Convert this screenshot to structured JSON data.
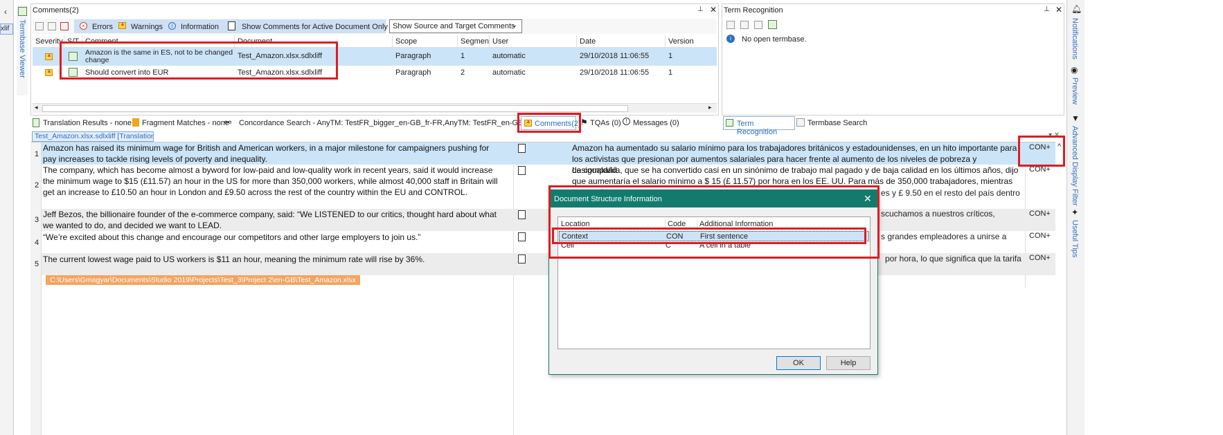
{
  "comments_panel": {
    "title": "Comments(2)",
    "toolbar": {
      "errors_label": "Errors",
      "warnings_label": "Warnings",
      "information_label": "Information",
      "active_doc_label": "Show Comments for Active Document Only",
      "dropdown_value": "Show Source and Target Comments"
    },
    "columns": [
      "Severity",
      "S/T",
      "Comment",
      "Document",
      "Scope",
      "Segmen",
      "User",
      "Date",
      "Version"
    ],
    "rows": [
      {
        "comment": "Amazon is the same in ES, not to be changed change",
        "comment_line1": "Amazon is the same in ES, not to be changed",
        "comment_line2": "change",
        "document": "Test_Amazon.xlsx.sdlxliff",
        "scope": "Paragraph",
        "segment": "1",
        "user": "automatic",
        "date": "29/10/2018 11:06:55",
        "version": "1"
      },
      {
        "comment": "Should convert into EUR",
        "document": "Test_Amazon.xlsx.sdlxliff",
        "scope": "Paragraph",
        "segment": "2",
        "user": "automatic",
        "date": "29/10/2018 11:06:55",
        "version": "1"
      }
    ]
  },
  "term_panel": {
    "title": "Term Recognition",
    "message": "No open termbase.",
    "tab_term": "Term Recognition",
    "tab_search": "Termbase Search"
  },
  "bottom_tabs": {
    "translation_results": "Translation Results - none",
    "fragment_matches": "Fragment Matches - none",
    "concordance": "Concordance Search - AnyTM: TestFR_bigger_en-GB_fr-FR,AnyTM: TestFR_en-GB_fr-FR",
    "comments": "Comments(2)",
    "tqas": "TQAs (0)",
    "messages": "Messages (0)"
  },
  "editor": {
    "doc_tab": "Test_Amazon.xlsx.sdlxliff [Translation]",
    "left_tab_fragment": "xlif",
    "file_path": "C:\\Users\\Gmagyar\\Documents\\Studio 2019\\Projects\\Test_3\\Project 2\\en-GB\\Test_Amazon.xlsx",
    "segments": [
      {
        "num": "1",
        "status": "CON+",
        "source": "Amazon has raised its minimum wage for British and American workers, in a major milestone for campaigners pushing for pay increases to tackle rising levels of poverty and inequality.",
        "target": "Amazon ha aumentado su salario mínimo para los trabajadores británicos y estadounidenses, en un hito importante para los activistas que presionan por aumentos salariales para hacer frente al aumento de los niveles de pobreza y desigualdad."
      },
      {
        "num": "2",
        "status": "CON+",
        "source": "The company, which has become almost a byword for low-paid and low-quality work in recent years, said it would increase the minimum wage to $15 (£11.57) an hour in the US for more than 350,000 workers, while almost 40,000 staff in Britain will get an increase to £10.50 an hour in London and £9.50 across the rest of the country within the EU and CONTROL.",
        "target": "La compañía, que se ha convertido casi en un sinónimo de trabajo mal pagado y de baja calidad en los últimos años, dijo que aumentaría el salario mínimo a $ 15 (£ 11.57) por hora en los EE. UU. Para más de 350,000 trabajadores, mientras que casi",
        "target_tail": "es y £ 9.50 en el resto del país dentro"
      },
      {
        "num": "3",
        "status": "CON+",
        "source": "Jeff Bezos, the billionaire founder of the e-commerce company, said: “We LISTENED to our critics, thought hard about what we wanted to do, and decided we want to LEAD.",
        "target_tail": "scuchamos a nuestros críticos,"
      },
      {
        "num": "4",
        "status": "CON+",
        "source": "“We’re excited about this change and encourage our competitors and other large employers to join us.”",
        "target_tail": "s grandes empleadores a unirse a"
      },
      {
        "num": "5",
        "status": "CON+",
        "source": "The current lowest wage paid to US workers is $11 an hour, meaning the minimum rate will rise by 36%.",
        "target_tail": "por hora, lo que significa que la tarifa"
      }
    ]
  },
  "dialog": {
    "title": "Document Structure Information",
    "columns": [
      "Location",
      "Code",
      "Additional Information"
    ],
    "rows": [
      {
        "location": "Context",
        "code": "CON",
        "info": "First sentence"
      },
      {
        "location": "Cell",
        "code": "C",
        "info": "A cell in a table"
      }
    ],
    "ok_label": "OK",
    "help_label": "Help"
  },
  "side_tabs": {
    "left": "Termbase Viewer",
    "notifications": "Notifications",
    "preview": "Preview",
    "advanced_filter": "Advanced Display Filter",
    "useful_tips": "Useful Tips"
  },
  "colors": {
    "selected_row": "#cce4f7",
    "dialog_header": "#127b6e",
    "highlight_red": "#e01b22",
    "path_bar": "#f4a460"
  }
}
